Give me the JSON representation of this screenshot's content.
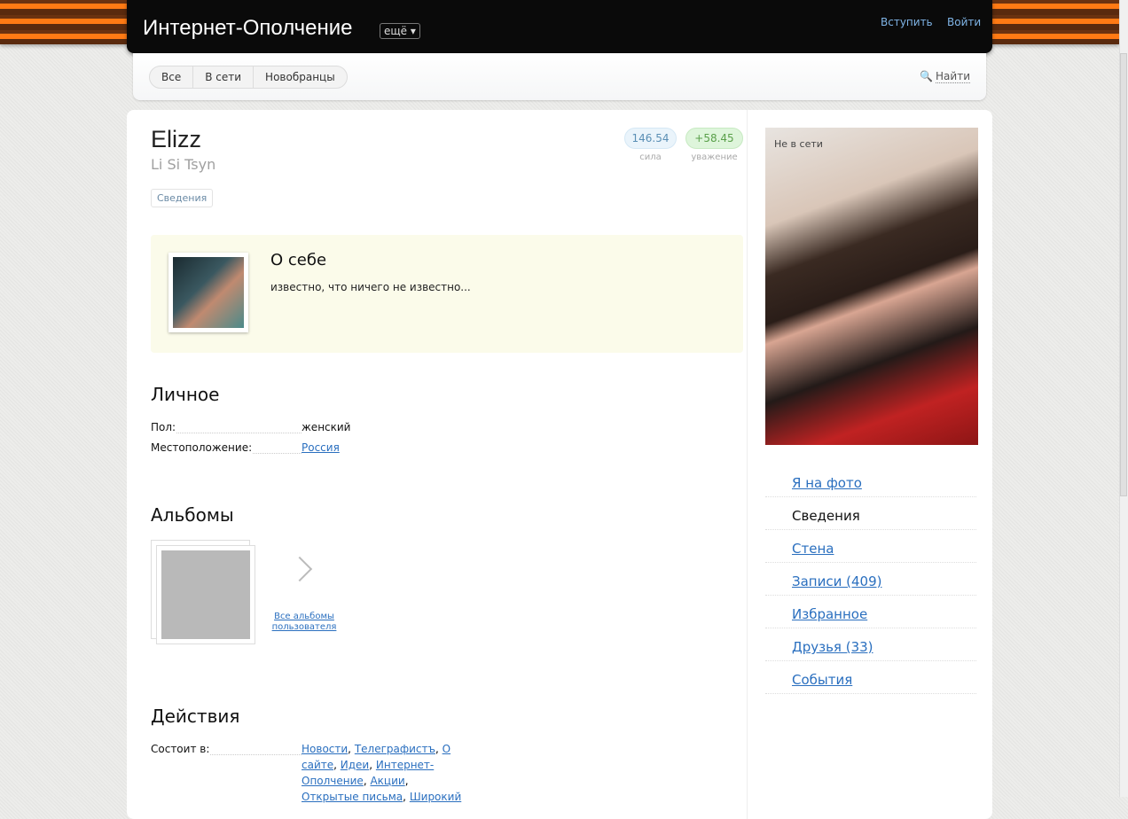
{
  "header": {
    "title": "Интернет-Ополчение",
    "more": "ещё ▾",
    "join": "Вступить",
    "login": "Войти"
  },
  "subnav": {
    "tabs": [
      "Все",
      "В сети",
      "Новобранцы"
    ],
    "find": "Найти"
  },
  "profile": {
    "name": "Elizz",
    "realname": "Li Si Tsyn",
    "tab": "Сведения",
    "power": "146.54",
    "power_label": "сила",
    "respect": "+58.45",
    "respect_label": "уважение"
  },
  "about": {
    "title": "О себе",
    "text": "известно, что ничего не известно..."
  },
  "personal": {
    "title": "Личное",
    "gender_label": "Пол:",
    "gender": "женский",
    "location_label": "Местоположение:",
    "location": "Россия"
  },
  "albums": {
    "title": "Альбомы",
    "all": "Все альбомы пользователя"
  },
  "actions": {
    "title": "Действия",
    "member_label": "Состоит в:",
    "groups": [
      "Новости",
      "Телеграфистъ",
      "О сайте",
      "Идеи",
      "Интернет-Ополчение",
      "Акции",
      "Открытые письма",
      "Широкий"
    ]
  },
  "sidebar": {
    "status": "Не в сети",
    "items": [
      "Я на фото",
      "Сведения",
      "Стена",
      "Записи (409)",
      "Избранное",
      "Друзья (33)",
      "События"
    ]
  }
}
